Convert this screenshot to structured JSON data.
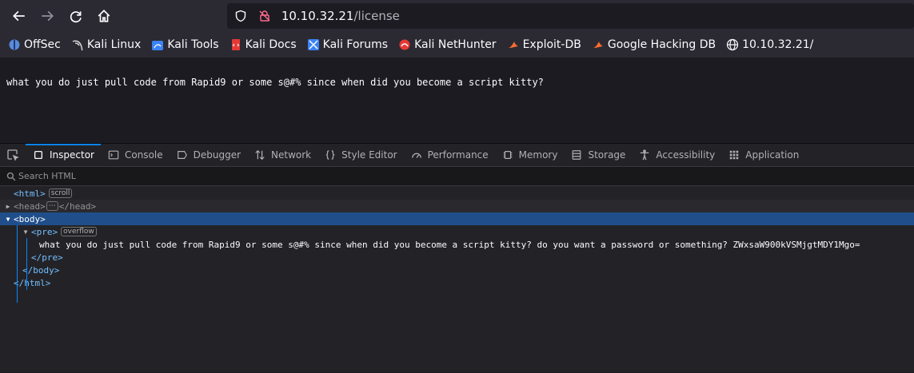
{
  "browser": {
    "url_host": "10.10.32.21",
    "url_path": "/license"
  },
  "bookmarks": [
    {
      "label": "OffSec",
      "icon": "offsec-icon",
      "color": "#5a8bd6"
    },
    {
      "label": "Kali Linux",
      "icon": "kali-dragon-icon",
      "color": "#d9d9d9"
    },
    {
      "label": "Kali Tools",
      "icon": "kali-tools-icon",
      "color": "#3b82f6"
    },
    {
      "label": "Kali Docs",
      "icon": "kali-docs-icon",
      "color": "#e53935"
    },
    {
      "label": "Kali Forums",
      "icon": "kali-forums-icon",
      "color": "#3b82f6"
    },
    {
      "label": "Kali NetHunter",
      "icon": "nethunter-icon",
      "color": "#e53935"
    },
    {
      "label": "Exploit-DB",
      "icon": "exploitdb-icon",
      "color": "#ff6d2e"
    },
    {
      "label": "Google Hacking DB",
      "icon": "ghdb-icon",
      "color": "#ff6d2e"
    },
    {
      "label": "10.10.32.21/",
      "icon": "globe-icon",
      "color": "#fbfbfe"
    }
  ],
  "page": {
    "text": "what you do just pull code from Rapid9 or some s@#% since when did you become a script kitty?"
  },
  "devtools": {
    "tabs": [
      {
        "label": "Inspector",
        "icon": "inspector-icon",
        "active": true
      },
      {
        "label": "Console",
        "icon": "console-icon"
      },
      {
        "label": "Debugger",
        "icon": "debugger-icon"
      },
      {
        "label": "Network",
        "icon": "network-icon"
      },
      {
        "label": "Style Editor",
        "icon": "style-editor-icon"
      },
      {
        "label": "Performance",
        "icon": "performance-icon"
      },
      {
        "label": "Memory",
        "icon": "memory-icon"
      },
      {
        "label": "Storage",
        "icon": "storage-icon"
      },
      {
        "label": "Accessibility",
        "icon": "accessibility-icon"
      },
      {
        "label": "Application",
        "icon": "application-icon"
      }
    ],
    "search_placeholder": "Search HTML",
    "tree": {
      "html_open": "<html>",
      "html_badge": "scroll",
      "head_open": "<head>",
      "head_collapsed": "⋯",
      "head_close": "</head>",
      "body_open": "<body>",
      "pre_open": "<pre>",
      "pre_badge": "overflow",
      "pre_text": "what you do just pull code from Rapid9 or some s@#% since when did you become a script kitty? do you want a password or something? ZWxsaW900kVSMjgtMDY1Mgo=",
      "pre_close": "</pre>",
      "body_close": "</body>",
      "html_close": "</html>"
    }
  }
}
